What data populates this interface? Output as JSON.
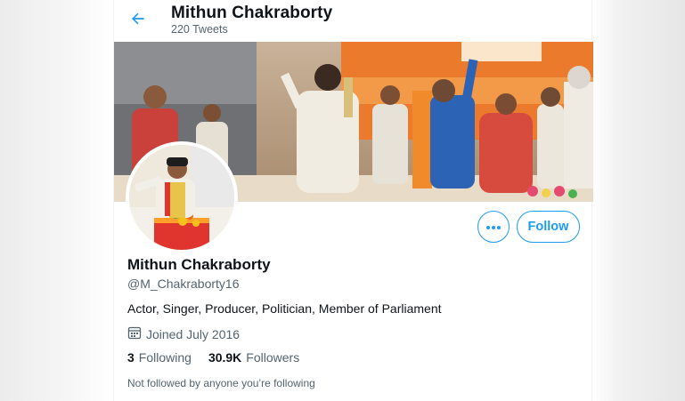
{
  "header": {
    "title": "Mithun Chakraborty",
    "tweet_count": "220 Tweets"
  },
  "icons": {
    "back": "arrow-left-icon",
    "more": "more-horizontal-icon",
    "calendar": "calendar-icon"
  },
  "colors": {
    "accent": "#1d9bf0",
    "text_primary": "#0f1419",
    "text_secondary": "#536471"
  },
  "profile": {
    "name": "Mithun Chakraborty",
    "handle": "@M_Chakraborty16",
    "bio": "Actor, Singer, Producer, Politician, Member of Parliament",
    "joined": "Joined July 2016",
    "following_count": "3",
    "following_label": "Following",
    "followers_count": "30.9K",
    "followers_label": "Followers",
    "follow_context": "Not followed by anyone you’re following"
  },
  "actions": {
    "follow_label": "Follow"
  }
}
